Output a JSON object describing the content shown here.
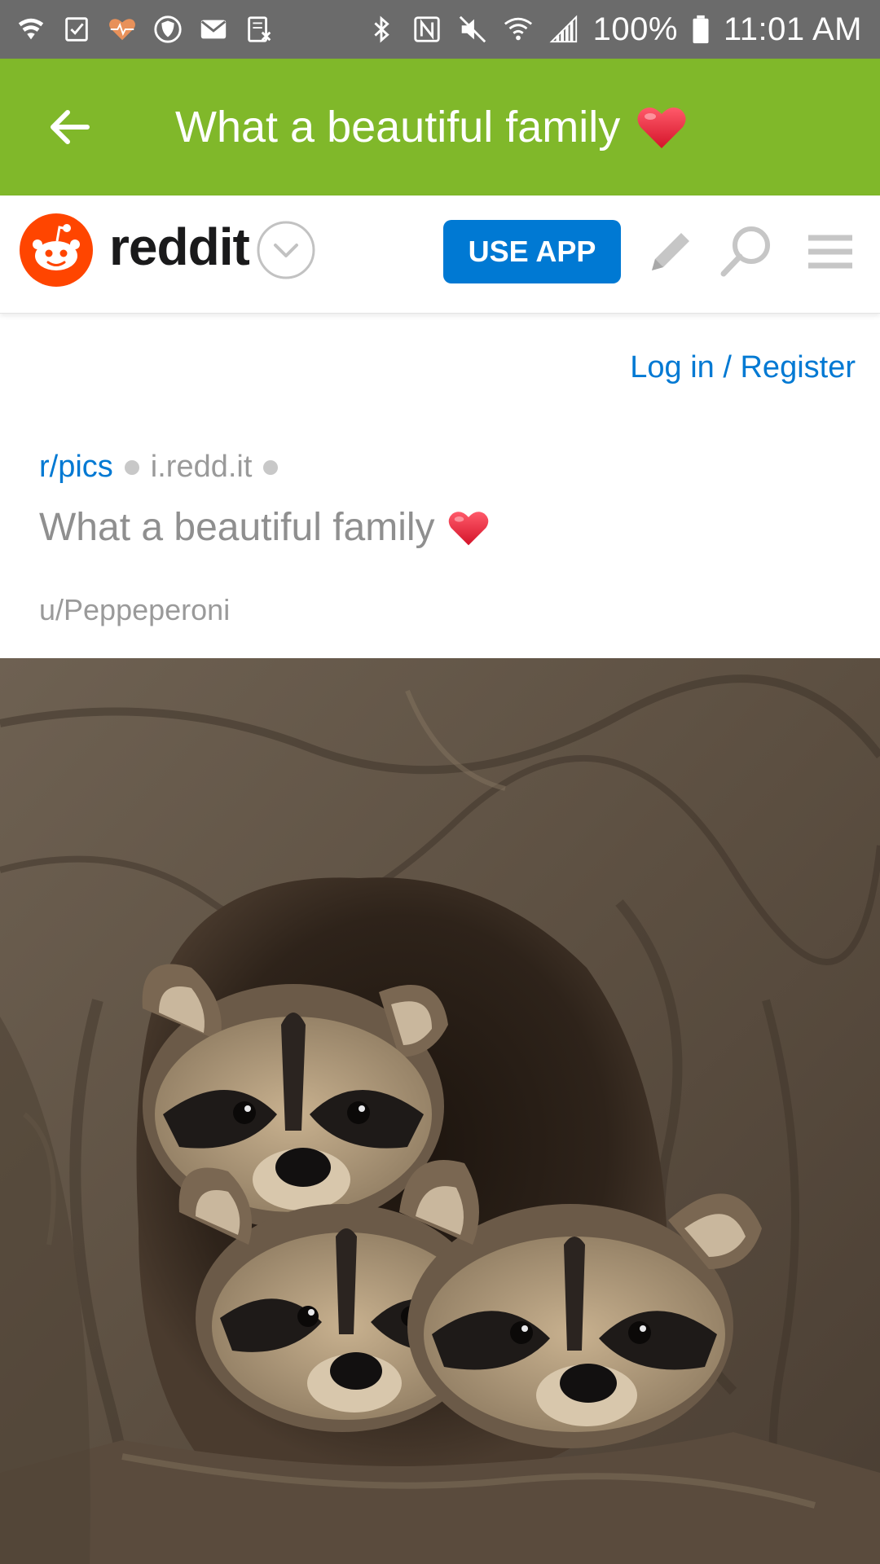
{
  "status_bar": {
    "battery_percent": "100%",
    "time": "11:01 AM",
    "left_icons": [
      "wifi-shield-icon",
      "checkbox-icon",
      "heart-pulse-icon",
      "security-shield-icon",
      "mail-icon",
      "cardx-icon"
    ],
    "right_icons": [
      "bluetooth-icon",
      "nfc-icon",
      "mute-icon",
      "wifi-icon",
      "signal-icon",
      "battery-icon"
    ]
  },
  "app_header": {
    "title": "What a beautiful family",
    "background": "#80b82a"
  },
  "reddit_header": {
    "wordmark": "reddit",
    "use_app_label": "USE APP",
    "accent": "#0079d3",
    "brand": "#ff4500"
  },
  "content": {
    "login_register": "Log in / Register",
    "subreddit": "r/pics",
    "domain": "i.redd.it",
    "post_title": "What a beautiful family",
    "author": "u/Peppeperoni"
  }
}
